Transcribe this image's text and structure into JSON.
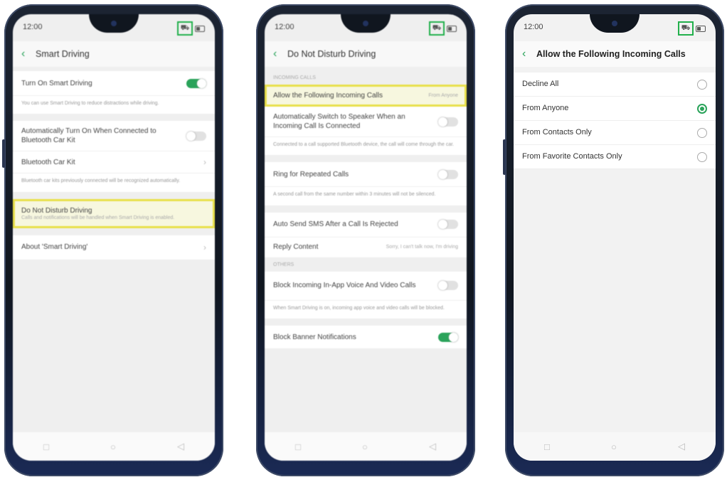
{
  "phone1": {
    "status_time": "12:00",
    "title": "Smart Driving",
    "rows": [
      {
        "label": "Turn On Smart Driving",
        "desc": "You can use Smart Driving to reduce distractions while driving."
      },
      {
        "label": "Automatically Turn On When Connected to Bluetooth Car Kit"
      },
      {
        "label": "Bluetooth Car Kit",
        "desc": "Bluetooth car kits previously connected will be recognized automatically."
      },
      {
        "label": "Do Not Disturb Driving",
        "desc": "Calls and notifications will be handled when Smart Driving is enabled."
      },
      {
        "label": "About 'Smart Driving'"
      }
    ]
  },
  "phone2": {
    "status_time": "12:00",
    "title": "Do Not Disturb Driving",
    "section1": "INCOMING CALLS",
    "section2": "OTHERS",
    "rows": [
      {
        "label": "Allow the Following Incoming Calls",
        "value": "From Anyone"
      },
      {
        "label": "Automatically Switch to Speaker When an Incoming Call Is Connected",
        "desc": "Connected to a call supported Bluetooth device, the call will come through the car."
      },
      {
        "label": "Ring for Repeated Calls",
        "desc": "A second call from the same number within 3 minutes will not be silenced."
      },
      {
        "label": "Auto Send SMS After a Call Is Rejected"
      },
      {
        "label": "Reply Content",
        "value": "Sorry, I can't talk now, I'm driving"
      },
      {
        "label": "Block Incoming In-App Voice And Video Calls",
        "desc": "When Smart Driving is on, incoming app voice and video calls will be blocked."
      },
      {
        "label": "Block Banner Notifications"
      }
    ]
  },
  "phone3": {
    "status_time": "12:00",
    "title": "Allow the Following Incoming Calls",
    "options": [
      {
        "label": "Decline All",
        "selected": false
      },
      {
        "label": "From Anyone",
        "selected": true
      },
      {
        "label": "From Contacts Only",
        "selected": false
      },
      {
        "label": "From Favorite Contacts Only",
        "selected": false
      }
    ]
  },
  "colors": {
    "accent": "#2aa35a",
    "highlight": "#e8e04a",
    "status_box": "#22b04b"
  }
}
